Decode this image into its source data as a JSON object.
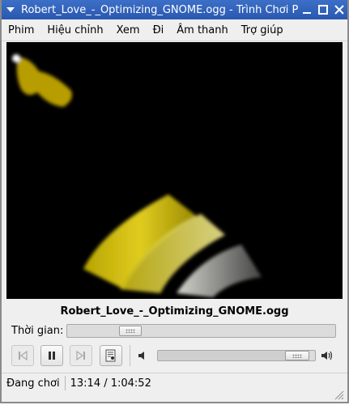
{
  "window": {
    "title": "Robert_Love_-_Optimizing_GNOME.ogg - Trình Chơi Ph"
  },
  "menubar": {
    "items": [
      {
        "label": "Phim"
      },
      {
        "label": "Hiệu chỉnh"
      },
      {
        "label": "Xem"
      },
      {
        "label": "Đi"
      },
      {
        "label": "Âm thanh"
      },
      {
        "label": "Trợ giúp"
      }
    ]
  },
  "player": {
    "filename": "Robert_Love_-_Optimizing_GNOME.ogg",
    "time_label": "Thời gian:",
    "seek_progress": 0.21,
    "volume_level": 0.96
  },
  "status": {
    "state": "Đang chơi",
    "time": "13:14 / 1:04:52"
  },
  "icons": {
    "window_menu": "window-menu-icon",
    "minimize": "minimize-icon",
    "maximize": "maximize-icon",
    "close": "close-icon",
    "previous": "skip-previous-icon",
    "pause": "pause-icon",
    "next": "skip-next-icon",
    "playlist": "playlist-icon",
    "volume_low": "volume-low-icon",
    "volume_high": "volume-high-icon"
  }
}
